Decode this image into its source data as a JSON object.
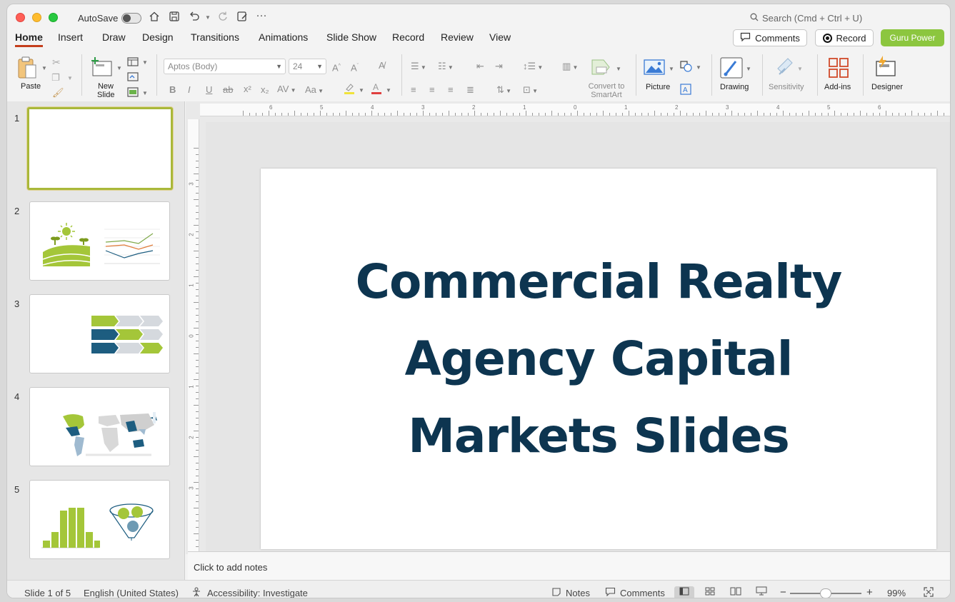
{
  "titlebar": {
    "autosave_label": "AutoSave",
    "search_placeholder": "Search (Cmd + Ctrl + U)"
  },
  "tabs": [
    {
      "label": "Home",
      "active": true
    },
    {
      "label": "Insert"
    },
    {
      "label": "Draw"
    },
    {
      "label": "Design"
    },
    {
      "label": "Transitions"
    },
    {
      "label": "Animations"
    },
    {
      "label": "Slide Show"
    },
    {
      "label": "Record"
    },
    {
      "label": "Review"
    },
    {
      "label": "View"
    }
  ],
  "header_buttons": {
    "comments": "Comments",
    "record": "Record",
    "guru": "Guru Power"
  },
  "ribbon": {
    "paste": "Paste",
    "new_slide": "New Slide",
    "font_name": "Aptos (Body)",
    "font_size": "24",
    "convert_smartart": "Convert to SmartArt",
    "picture": "Picture",
    "drawing": "Drawing",
    "sensitivity": "Sensitivity",
    "addins": "Add-ins",
    "designer": "Designer"
  },
  "thumbnails": [
    {
      "num": "1"
    },
    {
      "num": "2"
    },
    {
      "num": "3"
    },
    {
      "num": "4"
    },
    {
      "num": "5"
    }
  ],
  "ruler": {
    "h_ticks": [
      "6",
      "5",
      "4",
      "3",
      "2",
      "1",
      "0",
      "1",
      "2",
      "3",
      "4",
      "5",
      "6"
    ],
    "v_ticks": [
      "3",
      "2",
      "1",
      "0",
      "1",
      "2",
      "3"
    ]
  },
  "slide": {
    "title": "Commercial Realty Agency Capital Markets Slides"
  },
  "notes": {
    "placeholder": "Click to add notes"
  },
  "status": {
    "slide_info": "Slide 1 of 5",
    "language": "English (United States)",
    "accessibility": "Accessibility: Investigate",
    "notes": "Notes",
    "comments": "Comments",
    "zoom": "99%"
  },
  "colors": {
    "accent_green": "#8cc63f",
    "title_navy": "#0d3550",
    "tab_underline": "#c43e1c"
  }
}
